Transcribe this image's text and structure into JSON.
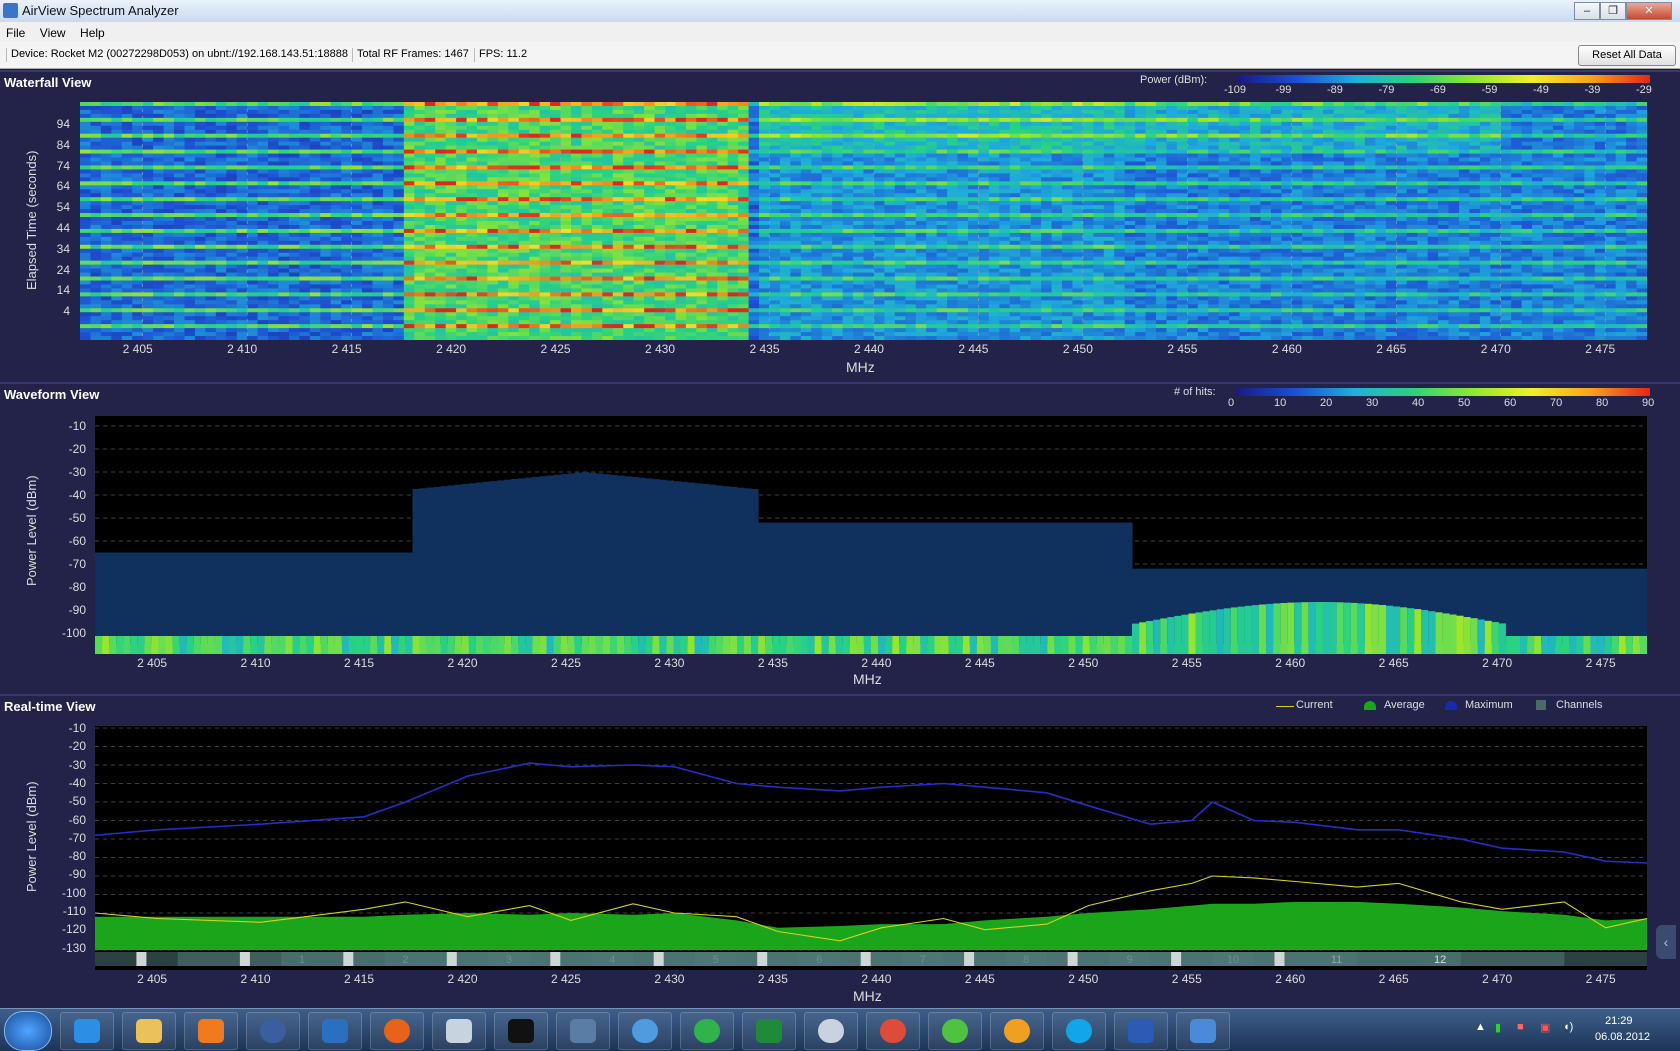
{
  "window": {
    "title": "AirView Spectrum Analyzer"
  },
  "menu": [
    "File",
    "View",
    "Help"
  ],
  "infobar": {
    "device": "Device: Rocket M2 (00272298D053) on ubnt://192.168.143.51:18888",
    "frames": "Total RF Frames: 1467",
    "fps": "FPS: 11.2",
    "reset_label": "Reset All Data"
  },
  "x_axis": {
    "label": "MHz",
    "ticks": [
      "2 405",
      "2 410",
      "2 415",
      "2 420",
      "2 425",
      "2 430",
      "2 435",
      "2 440",
      "2 445",
      "2 450",
      "2 455",
      "2 460",
      "2 465",
      "2 470",
      "2 475"
    ],
    "range_mhz": [
      2402,
      2477
    ]
  },
  "waterfall": {
    "title": "Waterfall View",
    "ylabel": "Elapsed Time (seconds)",
    "yticks": [
      "94",
      "84",
      "74",
      "64",
      "54",
      "44",
      "34",
      "24",
      "14",
      "4"
    ],
    "legend_label": "Power (dBm):",
    "legend_ticks": [
      "-109",
      "-99",
      "-89",
      "-79",
      "-69",
      "-59",
      "-49",
      "-39",
      "-29"
    ]
  },
  "waveform": {
    "title": "Waveform View",
    "ylabel": "Power Level (dBm)",
    "yticks": [
      "-10",
      "-20",
      "-30",
      "-40",
      "-50",
      "-60",
      "-70",
      "-80",
      "-90",
      "-100"
    ],
    "legend_label": "# of hits:",
    "legend_ticks": [
      "0",
      "10",
      "20",
      "30",
      "40",
      "50",
      "60",
      "70",
      "80",
      "90"
    ]
  },
  "realtime": {
    "title": "Real-time View",
    "ylabel": "Power Level (dBm)",
    "yticks": [
      "-10",
      "-20",
      "-30",
      "-40",
      "-50",
      "-60",
      "-70",
      "-80",
      "-90",
      "-100",
      "-110",
      "-120",
      "-130"
    ],
    "legend": [
      "Current",
      "Average",
      "Maximum",
      "Channels"
    ],
    "channels": [
      "1",
      "2",
      "3",
      "4",
      "5",
      "6",
      "7",
      "8",
      "9",
      "10",
      "11",
      "12"
    ]
  },
  "colors": {
    "current": "#d8d020",
    "average": "#1aa51a",
    "maximum": "#1a2ab0",
    "channels": "#4a6a6a",
    "panel_bg": "#23234a"
  },
  "chart_data": [
    {
      "type": "line",
      "title": "Real-time View",
      "xlabel": "MHz",
      "ylabel": "Power Level (dBm)",
      "xlim": [
        2402,
        2477
      ],
      "ylim": [
        -130,
        -10
      ],
      "x": [
        2402,
        2405,
        2410,
        2415,
        2417,
        2420,
        2423,
        2425,
        2428,
        2430,
        2433,
        2435,
        2438,
        2440,
        2443,
        2445,
        2448,
        2450,
        2453,
        2455,
        2456,
        2458,
        2460,
        2463,
        2465,
        2468,
        2470,
        2473,
        2475,
        2477
      ],
      "series": [
        {
          "name": "Maximum",
          "values": [
            -68,
            -65,
            -62,
            -58,
            -50,
            -36,
            -29,
            -31,
            -30,
            -31,
            -40,
            -42,
            -44,
            -42,
            -40,
            -42,
            -45,
            -52,
            -62,
            -60,
            -50,
            -60,
            -61,
            -65,
            -65,
            -70,
            -75,
            -77,
            -82,
            -83
          ]
        },
        {
          "name": "Average",
          "values": [
            -112,
            -112,
            -112,
            -112,
            -111,
            -110,
            -111,
            -110,
            -111,
            -110,
            -114,
            -118,
            -117,
            -116,
            -116,
            -114,
            -112,
            -110,
            -108,
            -106,
            -105,
            -105,
            -104,
            -104,
            -105,
            -107,
            -109,
            -111,
            -114,
            -113
          ]
        },
        {
          "name": "Current",
          "values": [
            -110,
            -113,
            -115,
            -108,
            -104,
            -112,
            -106,
            -114,
            -105,
            -110,
            -112,
            -120,
            -125,
            -118,
            -113,
            -119,
            -116,
            -106,
            -98,
            -94,
            -90,
            -91,
            -93,
            -96,
            -94,
            -104,
            -108,
            -104,
            -118,
            -113
          ]
        }
      ]
    }
  ]
}
